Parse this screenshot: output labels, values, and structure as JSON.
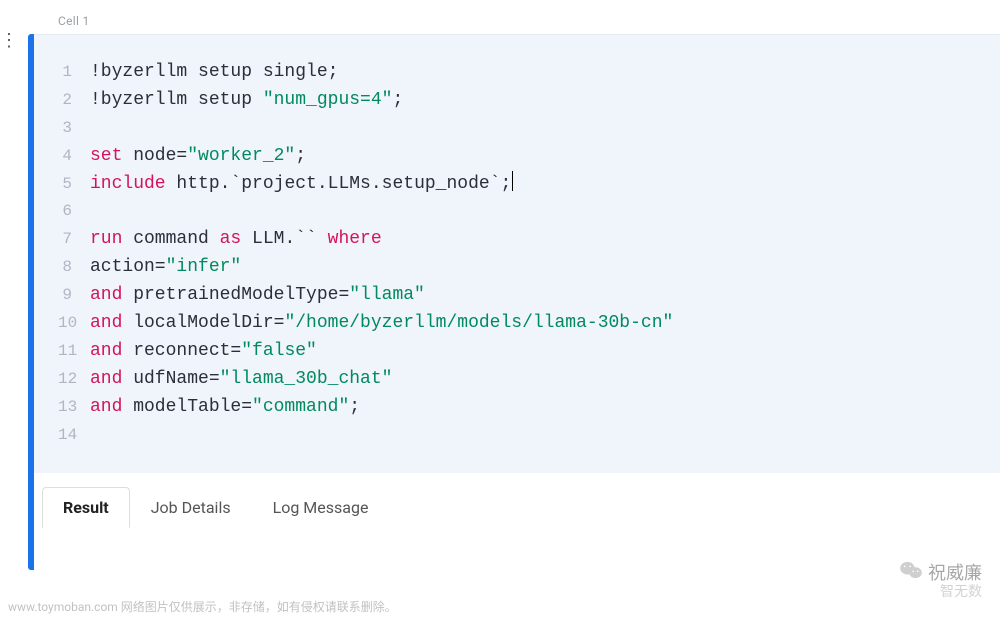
{
  "cell": {
    "label": "Cell 1"
  },
  "code": {
    "lines": [
      {
        "n": 1,
        "tokens": [
          {
            "t": "!byzerllm setup single;",
            "c": "cmd"
          }
        ]
      },
      {
        "n": 2,
        "tokens": [
          {
            "t": "!byzerllm setup ",
            "c": "cmd"
          },
          {
            "t": "\"num_gpus=4\"",
            "c": "str"
          },
          {
            "t": ";",
            "c": "punct"
          }
        ]
      },
      {
        "n": 3,
        "tokens": []
      },
      {
        "n": 4,
        "tokens": [
          {
            "t": "set",
            "c": "kw"
          },
          {
            "t": " node=",
            "c": "cmd"
          },
          {
            "t": "\"worker_2\"",
            "c": "str"
          },
          {
            "t": ";",
            "c": "punct"
          }
        ]
      },
      {
        "n": 5,
        "tokens": [
          {
            "t": "include",
            "c": "kw"
          },
          {
            "t": " http.`project.LLMs.setup_node`;",
            "c": "cmd"
          }
        ],
        "cursor": true
      },
      {
        "n": 6,
        "tokens": []
      },
      {
        "n": 7,
        "tokens": [
          {
            "t": "run",
            "c": "kw"
          },
          {
            "t": " command ",
            "c": "cmd"
          },
          {
            "t": "as",
            "c": "kw"
          },
          {
            "t": " LLM.`` ",
            "c": "cmd"
          },
          {
            "t": "where",
            "c": "kw"
          }
        ]
      },
      {
        "n": 8,
        "tokens": [
          {
            "t": "action=",
            "c": "cmd"
          },
          {
            "t": "\"infer\"",
            "c": "str"
          }
        ]
      },
      {
        "n": 9,
        "tokens": [
          {
            "t": "and",
            "c": "kw"
          },
          {
            "t": " pretrainedModelType=",
            "c": "cmd"
          },
          {
            "t": "\"llama\"",
            "c": "str"
          }
        ]
      },
      {
        "n": 10,
        "tokens": [
          {
            "t": "and",
            "c": "kw"
          },
          {
            "t": " localModelDir=",
            "c": "cmd"
          },
          {
            "t": "\"/home/byzerllm/models/llama-30b-cn\"",
            "c": "str"
          }
        ]
      },
      {
        "n": 11,
        "tokens": [
          {
            "t": "and",
            "c": "kw"
          },
          {
            "t": " reconnect=",
            "c": "cmd"
          },
          {
            "t": "\"false\"",
            "c": "str"
          }
        ]
      },
      {
        "n": 12,
        "tokens": [
          {
            "t": "and",
            "c": "kw"
          },
          {
            "t": " udfName=",
            "c": "cmd"
          },
          {
            "t": "\"llama_30b_chat\"",
            "c": "str"
          }
        ]
      },
      {
        "n": 13,
        "tokens": [
          {
            "t": "and",
            "c": "kw"
          },
          {
            "t": " modelTable=",
            "c": "cmd"
          },
          {
            "t": "\"command\"",
            "c": "str"
          },
          {
            "t": ";",
            "c": "punct"
          }
        ]
      },
      {
        "n": 14,
        "tokens": []
      }
    ]
  },
  "tabs": [
    {
      "label": "Result",
      "active": true
    },
    {
      "label": "Job Details",
      "active": false
    },
    {
      "label": "Log Message",
      "active": false
    }
  ],
  "watermarks": {
    "left": "www.toymoban.com 网络图片仅供展示，非存储，如有侵权请联系删除。",
    "right_name": "祝威廉",
    "right_sub": "智无数"
  },
  "leftstub": "⋮"
}
